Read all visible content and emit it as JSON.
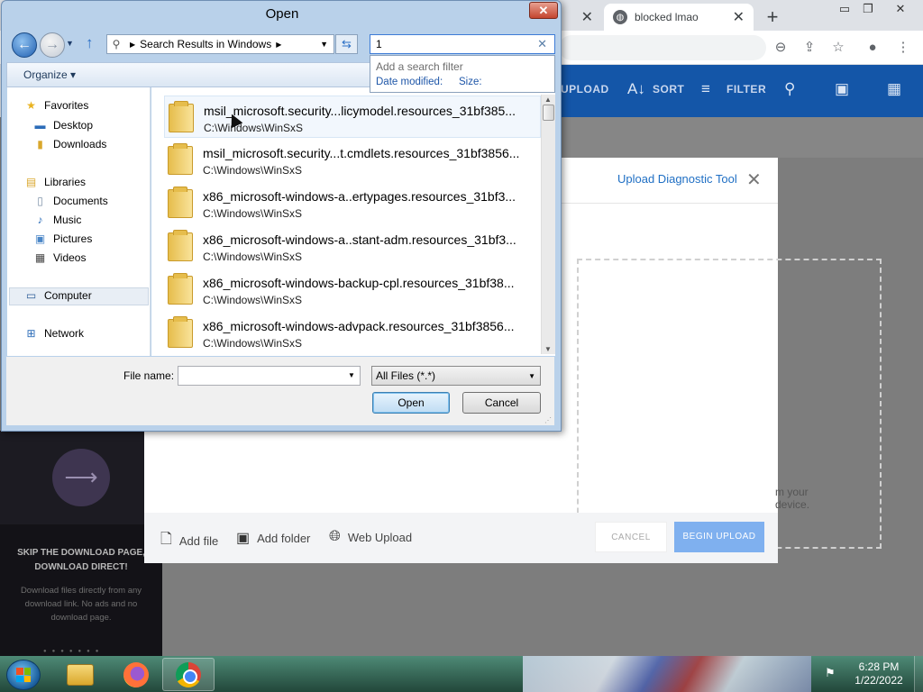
{
  "browser": {
    "tabs": [
      {
        "label": "",
        "active": false
      },
      {
        "label": "",
        "active": false
      },
      {
        "label": "",
        "active": false
      },
      {
        "label": "",
        "active": false
      },
      {
        "label": "blocked lmao",
        "active": true
      }
    ],
    "window_controls": {
      "minimize": "▭",
      "restore": "❐",
      "close": "✕"
    }
  },
  "site": {
    "header_items": [
      "UPLOAD",
      "SORT",
      "FILTER"
    ],
    "sidebar": {
      "title_line1": "SKIP THE DOWNLOAD PAGE,",
      "title_line2": "DOWNLOAD DIRECT!",
      "text_line1": "Download files directly from any",
      "text_line2": "download link. No ads and no",
      "text_line3": "download page."
    }
  },
  "upload_modal": {
    "title": "Upload Diagnostic Tool",
    "device_text": "m your device.",
    "footer": {
      "add_file": "Add file",
      "add_folder": "Add folder",
      "web_upload": "Web Upload",
      "cancel": "CANCEL",
      "begin_upload": "BEGIN UPLOAD"
    },
    "colors": {
      "accent": "#1f6fc4",
      "begin_button": "#7fb0ef"
    }
  },
  "dialog": {
    "title": "Open",
    "address": {
      "path_label": "Search Results in Windows"
    },
    "search": {
      "value": "1",
      "filter_title": "Add a search filter",
      "filter_date": "Date modified:",
      "filter_size": "Size:"
    },
    "toolbar": {
      "organize": "Organize"
    },
    "nav": {
      "favorites": "Favorites",
      "desktop": "Desktop",
      "downloads": "Downloads",
      "libraries": "Libraries",
      "documents": "Documents",
      "music": "Music",
      "pictures": "Pictures",
      "videos": "Videos",
      "computer": "Computer",
      "network": "Network"
    },
    "results": [
      {
        "name": "msil_microsoft.security...licymodel.resources_31bf385...",
        "path": "C:\\Windows\\WinSxS"
      },
      {
        "name": "msil_microsoft.security...t.cmdlets.resources_31bf3856...",
        "path": "C:\\Windows\\WinSxS"
      },
      {
        "name": "x86_microsoft-windows-a..ertypages.resources_31bf3...",
        "path": "C:\\Windows\\WinSxS"
      },
      {
        "name": "x86_microsoft-windows-a..stant-adm.resources_31bf3...",
        "path": "C:\\Windows\\WinSxS"
      },
      {
        "name": "x86_microsoft-windows-backup-cpl.resources_31bf38...",
        "path": "C:\\Windows\\WinSxS"
      },
      {
        "name": "x86_microsoft-windows-advpack.resources_31bf3856...",
        "path": "C:\\Windows\\WinSxS"
      }
    ],
    "filename": {
      "label": "File name:",
      "value": ""
    },
    "filetype": {
      "value": "All Files (*.*)"
    },
    "buttons": {
      "open": "Open",
      "cancel": "Cancel"
    }
  },
  "taskbar": {
    "apps": [
      "windows-explorer",
      "firefox",
      "chrome"
    ],
    "clock": {
      "time": "6:28 PM",
      "date": "1/22/2022"
    }
  }
}
